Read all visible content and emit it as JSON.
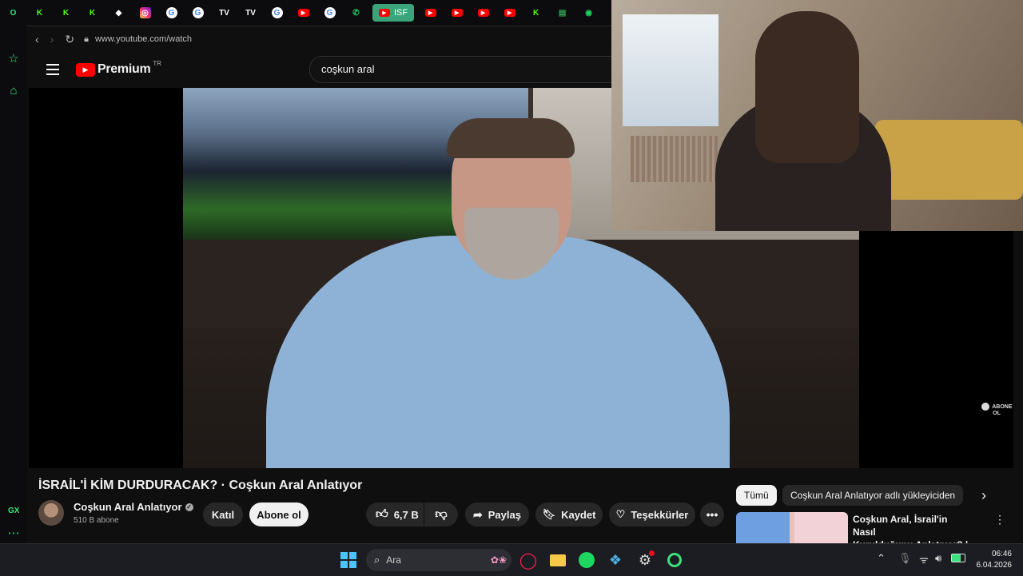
{
  "browser": {
    "tabs": [
      {
        "icon": "opera-icon",
        "glyph": "O",
        "color": "#39e27d"
      },
      {
        "icon": "kick-icon",
        "glyph": "K",
        "color": "#53fc18"
      },
      {
        "icon": "kick-icon",
        "glyph": "K",
        "color": "#53fc18"
      },
      {
        "icon": "kick-icon",
        "glyph": "K",
        "color": "#53fc18"
      },
      {
        "icon": "diamond-icon",
        "glyph": "◆",
        "color": "#ffffff"
      },
      {
        "icon": "instagram-icon",
        "glyph": "◎",
        "color": "#e1306c"
      },
      {
        "icon": "google-icon",
        "glyph": "G",
        "color": "#4285f4"
      },
      {
        "icon": "google-icon",
        "glyph": "G",
        "color": "#4285f4"
      },
      {
        "icon": "tradingview-icon",
        "glyph": "TV",
        "color": "#ffffff"
      },
      {
        "icon": "tradingview-icon",
        "glyph": "TV",
        "color": "#ffffff"
      },
      {
        "icon": "google-icon",
        "glyph": "G",
        "color": "#4285f4"
      },
      {
        "icon": "youtube-icon",
        "glyph": "▶",
        "color": "#ff0000"
      },
      {
        "icon": "google-icon",
        "glyph": "G",
        "color": "#4285f4"
      },
      {
        "icon": "whatsapp-icon",
        "glyph": "✆",
        "color": "#25d366"
      }
    ],
    "active_tab_label": "ISF",
    "tabs_after": [
      {
        "icon": "youtube-icon",
        "glyph": "▶",
        "color": "#ff0000"
      },
      {
        "icon": "youtube-icon",
        "glyph": "▶",
        "color": "#ff0000"
      },
      {
        "icon": "youtube-icon",
        "glyph": "▶",
        "color": "#ff0000"
      },
      {
        "icon": "youtube-icon",
        "glyph": "▶",
        "color": "#ff0000"
      },
      {
        "icon": "kick-icon",
        "glyph": "K",
        "color": "#53fc18"
      },
      {
        "icon": "document-icon",
        "glyph": "▤",
        "color": "#34a853"
      },
      {
        "icon": "spotify-icon",
        "glyph": "◉",
        "color": "#1ed760"
      },
      {
        "icon": "loading-icon",
        "glyph": "◌",
        "color": "#cccccc"
      }
    ],
    "url": "www.youtube.com/watch",
    "sidebar_bottom_label": "GX"
  },
  "youtube": {
    "logo_text": "Premium",
    "logo_superscript": "TR",
    "search_value": "coşkun aral",
    "video_watermark": "ABONE OL",
    "title": "İSRAİL'İ KİM DURDURACAK? · Coşkun Aral Anlatıyor",
    "channel_name": "Coşkun Aral Anlatıyor",
    "subscribers": "510 B abone",
    "join_label": "Katıl",
    "subscribe_label": "Abone ol",
    "like_count": "6,7 B",
    "share_label": "Paylaş",
    "save_label": "Kaydet",
    "thanks_label": "Teşekkürler",
    "chips": [
      "Tümü",
      "Coşkun Aral Anlatıyor adlı yükleyiciden"
    ],
    "recommended_title_line1": "Coşkun Aral, İsrail'in Nasıl",
    "recommended_title_line2": "Kurulduğunu Anlatıyor? | ..."
  },
  "taskbar": {
    "search_placeholder": "Ara",
    "time": "06:46",
    "date": "6.04.2026"
  }
}
